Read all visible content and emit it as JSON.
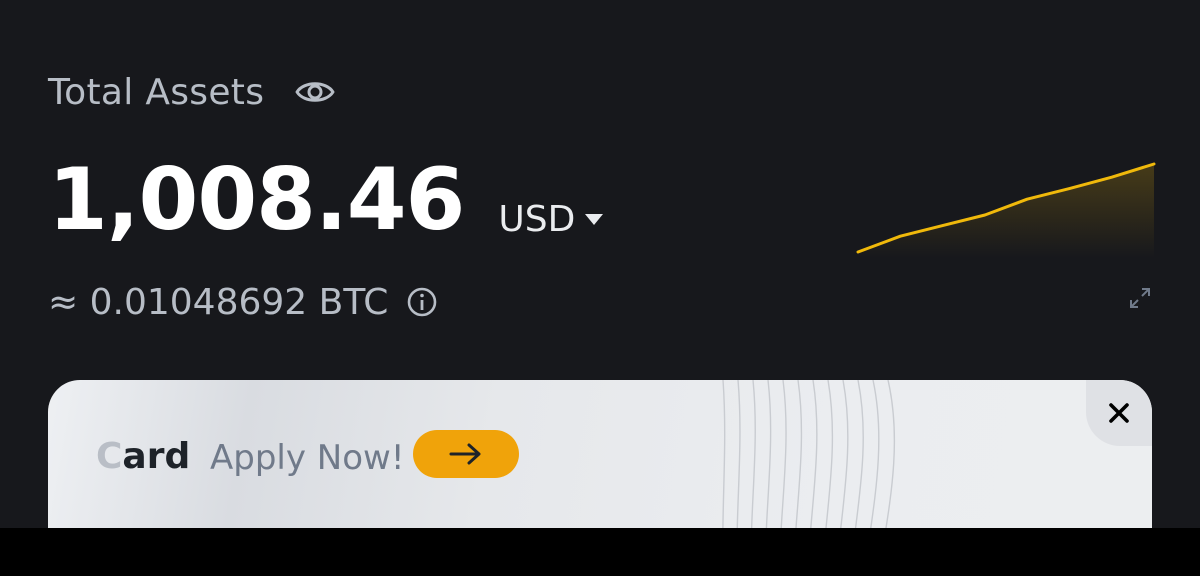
{
  "header": {
    "title": "Total Assets",
    "visibility_icon": "eye-icon"
  },
  "balance": {
    "value": "1,008.46",
    "currency": "USD",
    "currency_icon": "caret-down-icon"
  },
  "btc_equivalent": {
    "text": "≈ 0.01048692 BTC",
    "info_icon": "info-icon"
  },
  "sparkline": {
    "color": "#f0b90b",
    "trend_points": [
      0,
      0.18,
      0.3,
      0.42,
      0.6,
      0.72,
      0.85,
      1.0
    ],
    "expand_icon": "expand-icon"
  },
  "promo": {
    "title_prefix": "C",
    "title_rest": "ard",
    "cta_text": "Apply Now!",
    "arrow_icon": "arrow-right-icon",
    "close_icon": "close-icon",
    "accent_color": "#f0a30a"
  },
  "colors": {
    "background": "#17181c",
    "primary_text": "#ffffff",
    "secondary_text": "#b7bdc6",
    "brand": "#f0b90b"
  }
}
